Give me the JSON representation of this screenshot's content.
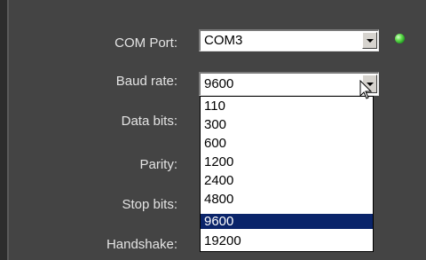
{
  "labels": {
    "com_port": "COM Port:",
    "baud_rate": "Baud rate:",
    "data_bits": "Data bits:",
    "parity": "Parity:",
    "stop_bits": "Stop bits:",
    "handshake": "Handshake:"
  },
  "com_port": {
    "value": "COM3",
    "status_led": "green-led-icon"
  },
  "baud_rate": {
    "value": "9600",
    "options": [
      "110",
      "300",
      "600",
      "1200",
      "2400",
      "4800",
      "9600",
      "19200"
    ],
    "selected": "9600"
  },
  "colors": {
    "background": "#444444",
    "selection": "#0a246a"
  }
}
